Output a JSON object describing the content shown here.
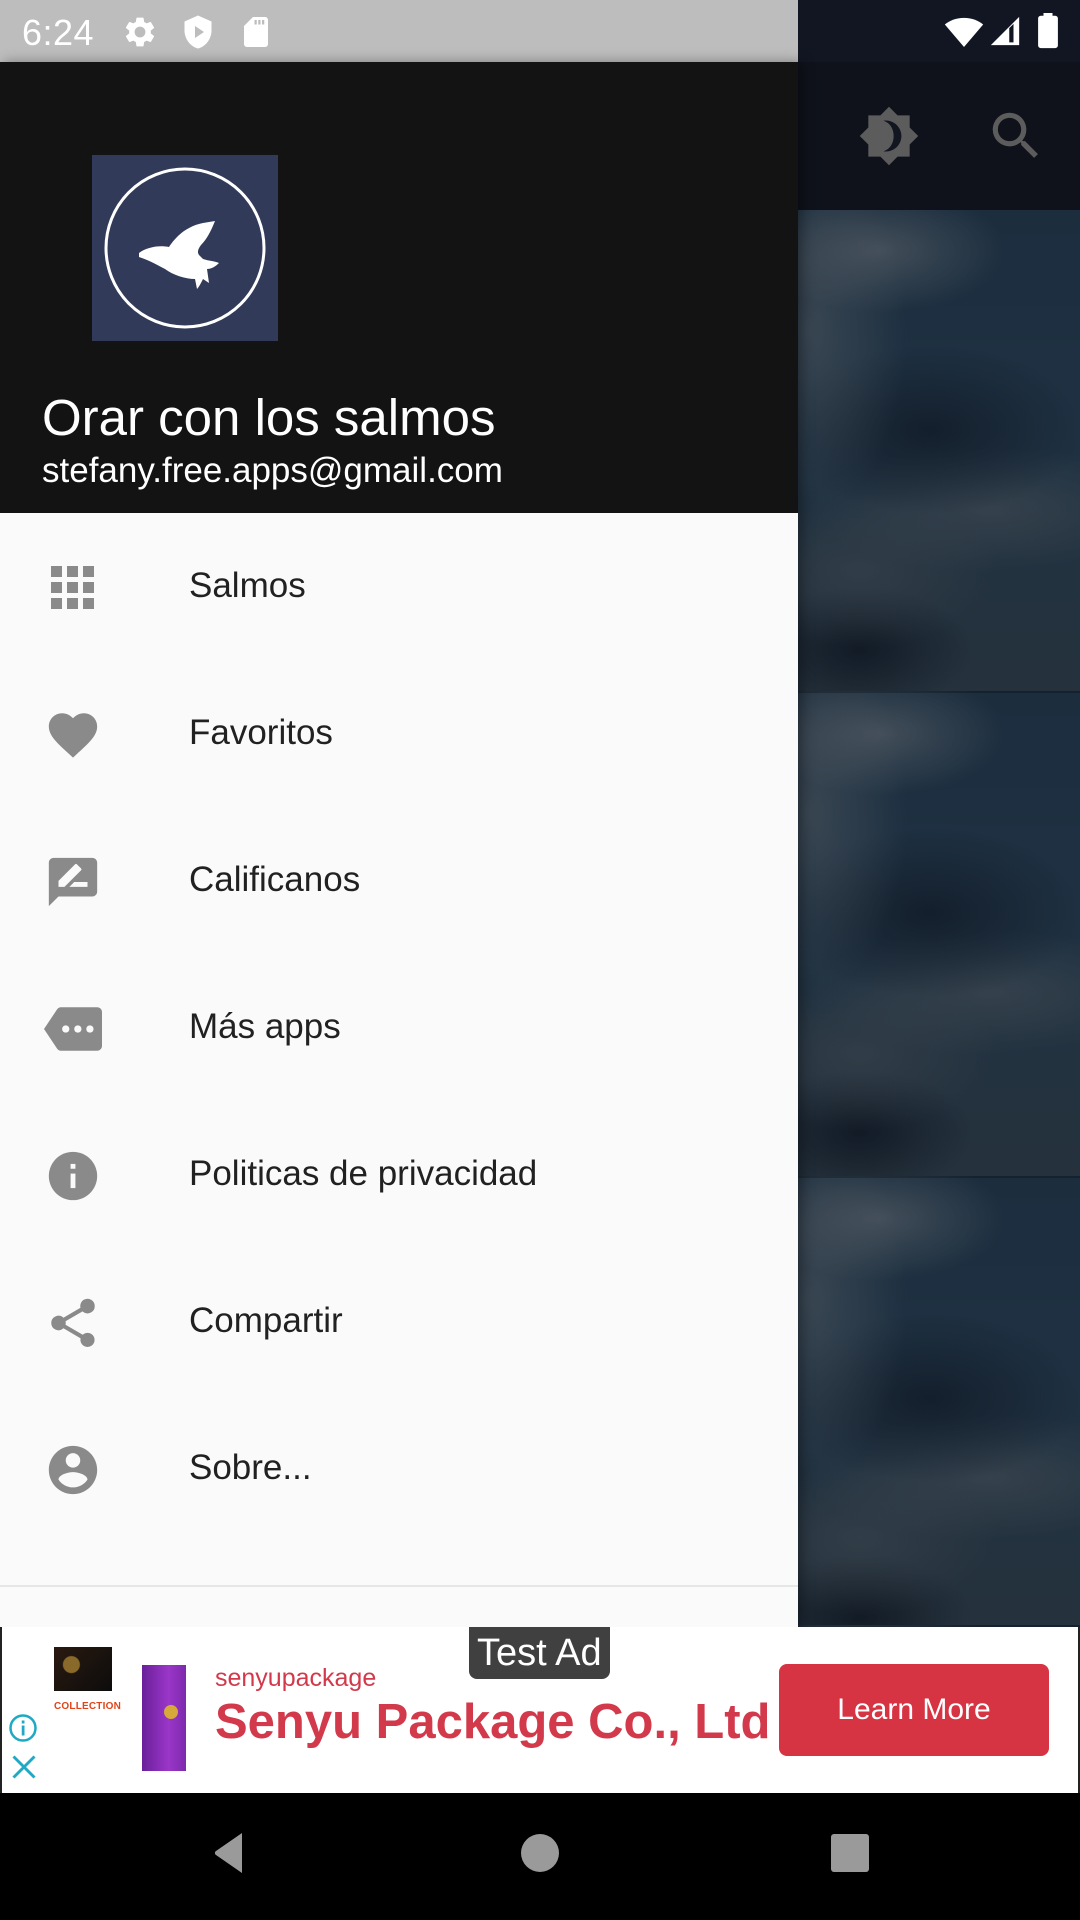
{
  "status_bar": {
    "time": "6:24",
    "left_icons": [
      "gear-icon",
      "shield-play-icon",
      "sd-card-icon"
    ],
    "right_icons": [
      "wifi-icon",
      "cell-signal-icon",
      "battery-icon"
    ]
  },
  "app_toolbar": {
    "actions": [
      {
        "name": "theme-toggle",
        "icon": "brightness-moon-icon"
      },
      {
        "name": "search",
        "icon": "search-icon"
      }
    ]
  },
  "drawer": {
    "header": {
      "logo": "dove-logo",
      "title": "Orar con los salmos",
      "email": "stefany.free.apps@gmail.com"
    },
    "items": [
      {
        "label": "Salmos",
        "icon": "grid-icon"
      },
      {
        "label": "Favoritos",
        "icon": "heart-icon"
      },
      {
        "label": "Calificanos",
        "icon": "rate-review-icon"
      },
      {
        "label": "Más apps",
        "icon": "more-tag-icon"
      },
      {
        "label": "Politicas de privacidad",
        "icon": "info-icon"
      },
      {
        "label": "Compartir",
        "icon": "share-icon"
      },
      {
        "label": "Sobre...",
        "icon": "account-circle-icon"
      }
    ]
  },
  "ad": {
    "badge": "Test Ad",
    "thumb_caption": "COLLECTION",
    "advertiser": "senyupackage",
    "headline": "Senyu Package Co., Ltd",
    "cta": "Learn More",
    "colors": {
      "brand": "#d2394b",
      "cta_bg": "#d63443",
      "adchoices": "#1fa9c4"
    }
  },
  "nav_bar": {
    "buttons": [
      "back",
      "home",
      "recents"
    ]
  },
  "colors": {
    "drawer_header_bg": "#131313",
    "drawer_bg": "#fafafa",
    "icon_gray": "#8a8a8a",
    "logo_bg": "#313a58",
    "logo_accent": "#4ba3b0"
  }
}
